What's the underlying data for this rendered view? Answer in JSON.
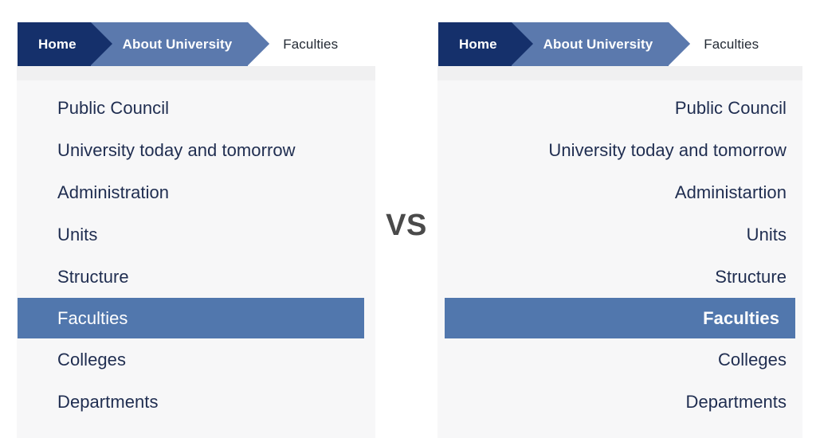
{
  "comparison": {
    "vs_label": "VS"
  },
  "colors": {
    "crumb_home_bg": "#15306b",
    "crumb_about_bg": "#5b79ad",
    "active_row_bg": "#5177ad",
    "list_text": "#1f2d50",
    "panel_bg": "#f7f7f8",
    "vs_text": "#4a4a4a"
  },
  "left_panel": {
    "name": "left-to-right-variant",
    "breadcrumb": {
      "items": [
        {
          "label": "Home",
          "state": "root"
        },
        {
          "label": "About University",
          "state": "parent"
        },
        {
          "label": "Faculties",
          "state": "current"
        }
      ]
    },
    "menu": {
      "items": [
        {
          "label": "Public Council",
          "active": false
        },
        {
          "label": "University today and tomorrow",
          "active": false
        },
        {
          "label": "Administration",
          "active": false
        },
        {
          "label": "Units",
          "active": false
        },
        {
          "label": "Structure",
          "active": false
        },
        {
          "label": "Faculties",
          "active": true
        },
        {
          "label": "Colleges",
          "active": false
        },
        {
          "label": "Departments",
          "active": false
        }
      ]
    }
  },
  "right_panel": {
    "name": "right-to-left-variant",
    "breadcrumb": {
      "items": [
        {
          "label": "Home",
          "state": "root"
        },
        {
          "label": "About University",
          "state": "parent"
        },
        {
          "label": "Faculties",
          "state": "current"
        }
      ]
    },
    "menu": {
      "items": [
        {
          "label": "Public Council",
          "active": false
        },
        {
          "label": "University today and tomorrow",
          "active": false
        },
        {
          "label": "Administartion",
          "active": false
        },
        {
          "label": "Units",
          "active": false
        },
        {
          "label": "Structure",
          "active": false
        },
        {
          "label": "Faculties",
          "active": true
        },
        {
          "label": "Colleges",
          "active": false
        },
        {
          "label": "Departments",
          "active": false
        }
      ]
    }
  }
}
